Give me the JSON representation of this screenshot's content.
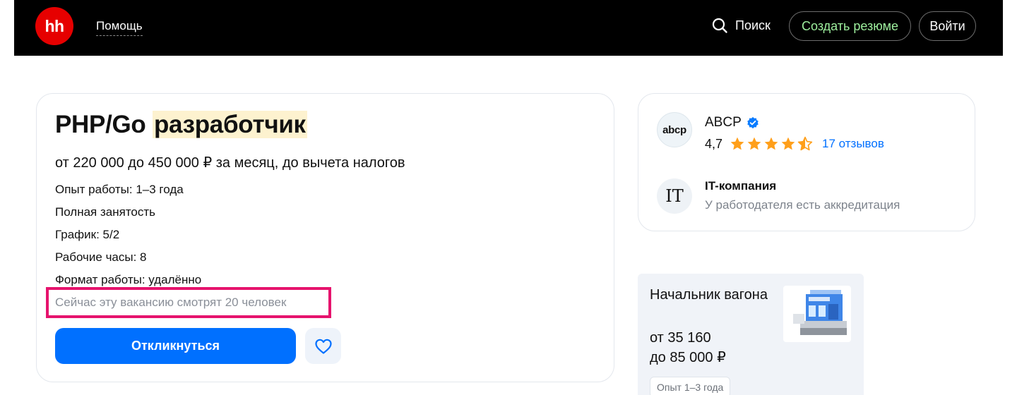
{
  "header": {
    "logo_text": "hh",
    "help_label": "Помощь",
    "search_label": "Поиск",
    "create_resume_label": "Создать резюме",
    "login_label": "Войти"
  },
  "vacancy": {
    "title_part1": "PHP/Go",
    "title_highlight": "разработчик",
    "salary": "от 220 000 до 450 000 ₽ за месяц, до вычета налогов",
    "experience": "Опыт работы: 1–3 года",
    "employment": "Полная занятость",
    "schedule": "График: 5/2",
    "hours": "Рабочие часы: 8",
    "work_format": "Формат работы: удалённо",
    "viewers": "Сейчас эту вакансию смотрят 20 человек",
    "apply_label": "Откликнуться"
  },
  "company": {
    "logo_text": "abcp",
    "name": "ABCP",
    "rating": "4,7",
    "stars_filled": 4.5,
    "reviews": "17 отзывов",
    "type_icon": "IT",
    "type_title": "IT-компания",
    "accreditation": "У работодателя есть аккредитация"
  },
  "promo": {
    "title": "Начальник вагона",
    "pay_line1": "от 35 160",
    "pay_line2": "до 85 000 ₽",
    "chip": "Опыт 1–3 года"
  },
  "colors": {
    "brand_red": "#e60000",
    "primary_blue": "#0070ff",
    "highlight_box": "#e6136d",
    "star": "#ff9f1a",
    "resume_green": "#9ef09e"
  }
}
